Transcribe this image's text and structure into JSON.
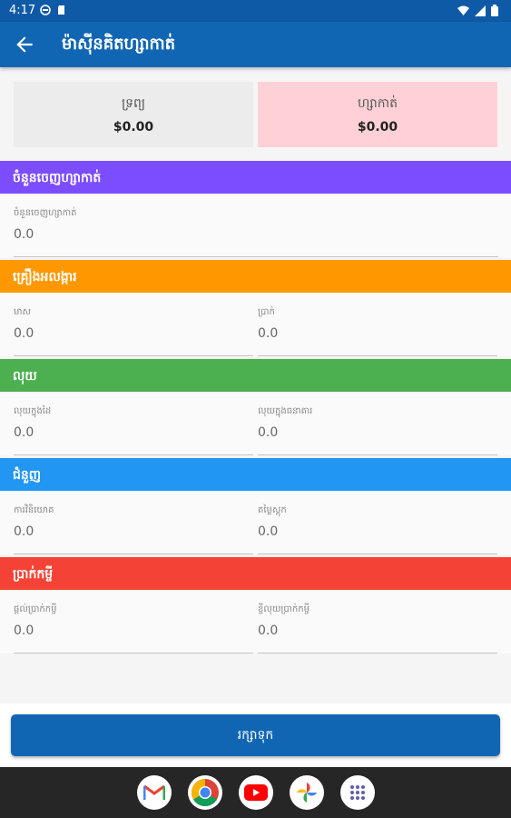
{
  "status_bar": {
    "time": "4:17"
  },
  "app_bar": {
    "title": "ម៉ាស៊ីនគិតហ្សាកាត់"
  },
  "summary": {
    "assets_label": "ទ្រព្យ",
    "assets_value": "$0.00",
    "liabilities_label": "ហ្សាកាត់",
    "liabilities_value": "$0.00"
  },
  "sections": [
    {
      "title": "ចំនួនចេញហ្សាកាត់",
      "color": "#7c4dff",
      "fields": [
        {
          "label": "ចំនួនចេញហ្សាកាត់",
          "value": "0.0"
        }
      ]
    },
    {
      "title": "គ្រឿងអលង្ការ",
      "color": "#ff9800",
      "fields": [
        {
          "label": "មាស",
          "value": "0.0"
        },
        {
          "label": "ប្រាក់",
          "value": "0.0"
        }
      ]
    },
    {
      "title": "លុយ",
      "color": "#4caf50",
      "fields": [
        {
          "label": "លុយក្នុងដៃ",
          "value": "0.0"
        },
        {
          "label": "លុយក្នុងធនាគារ",
          "value": "0.0"
        }
      ]
    },
    {
      "title": "ជំនួញ",
      "color": "#2196f3",
      "fields": [
        {
          "label": "ការវិនិយោគ",
          "value": "0.0"
        },
        {
          "label": "តម្លៃស្តុក",
          "value": "0.0"
        }
      ]
    },
    {
      "title": "ប្រាក់កម្ចី",
      "color": "#f44336",
      "fields": [
        {
          "label": "ផ្តល់ប្រាក់កម្ចី",
          "value": "0.0"
        },
        {
          "label": "ខ្ចីលុយប្រាក់កម្ចី",
          "value": "0.0"
        }
      ]
    }
  ],
  "save_button": {
    "label": "រក្សាទុក"
  },
  "dock": {
    "apps": [
      "gmail-icon",
      "chrome-icon",
      "youtube-icon",
      "photos-icon",
      "app-drawer-icon"
    ]
  }
}
